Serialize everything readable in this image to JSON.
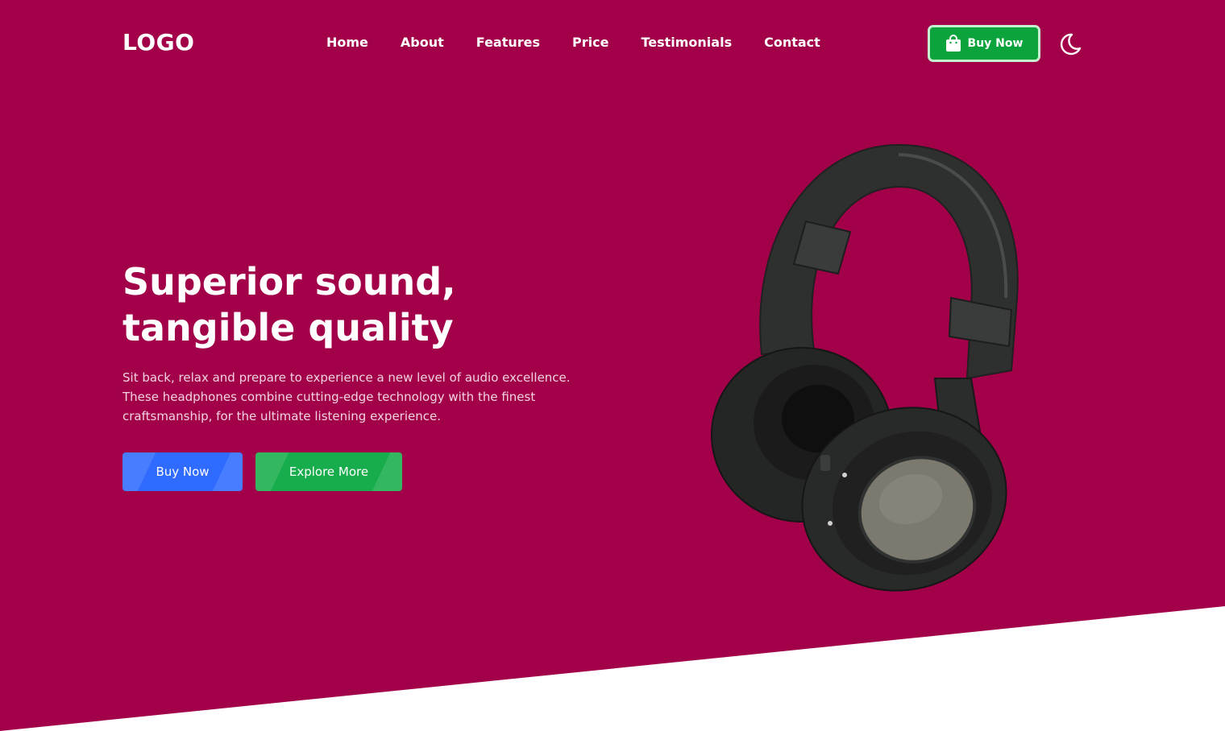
{
  "header": {
    "logo": "LOGO",
    "nav": [
      "Home",
      "About",
      "Features",
      "Price",
      "Testimonials",
      "Contact"
    ],
    "buy_label": "Buy Now",
    "buy_icon": "shopping-bag-icon",
    "theme_icon": "moon-icon"
  },
  "hero": {
    "title_line1": "Superior sound,",
    "title_line2": "tangible quality",
    "subtitle_line1": "Sit back, relax and prepare to experience a new level of audio excellence.",
    "subtitle_line2": "These headphones combine cutting-edge technology with the finest",
    "subtitle_line3": "craftsmanship, for the ultimate listening experience.",
    "primary_button": "Buy Now",
    "secondary_button": "Explore More",
    "image": "headphones-image"
  },
  "colors": {
    "hero_background": "#a3004a",
    "primary_button": "#2f6bff",
    "secondary_button": "#18ad4c",
    "header_buy": "#0aa33c"
  }
}
